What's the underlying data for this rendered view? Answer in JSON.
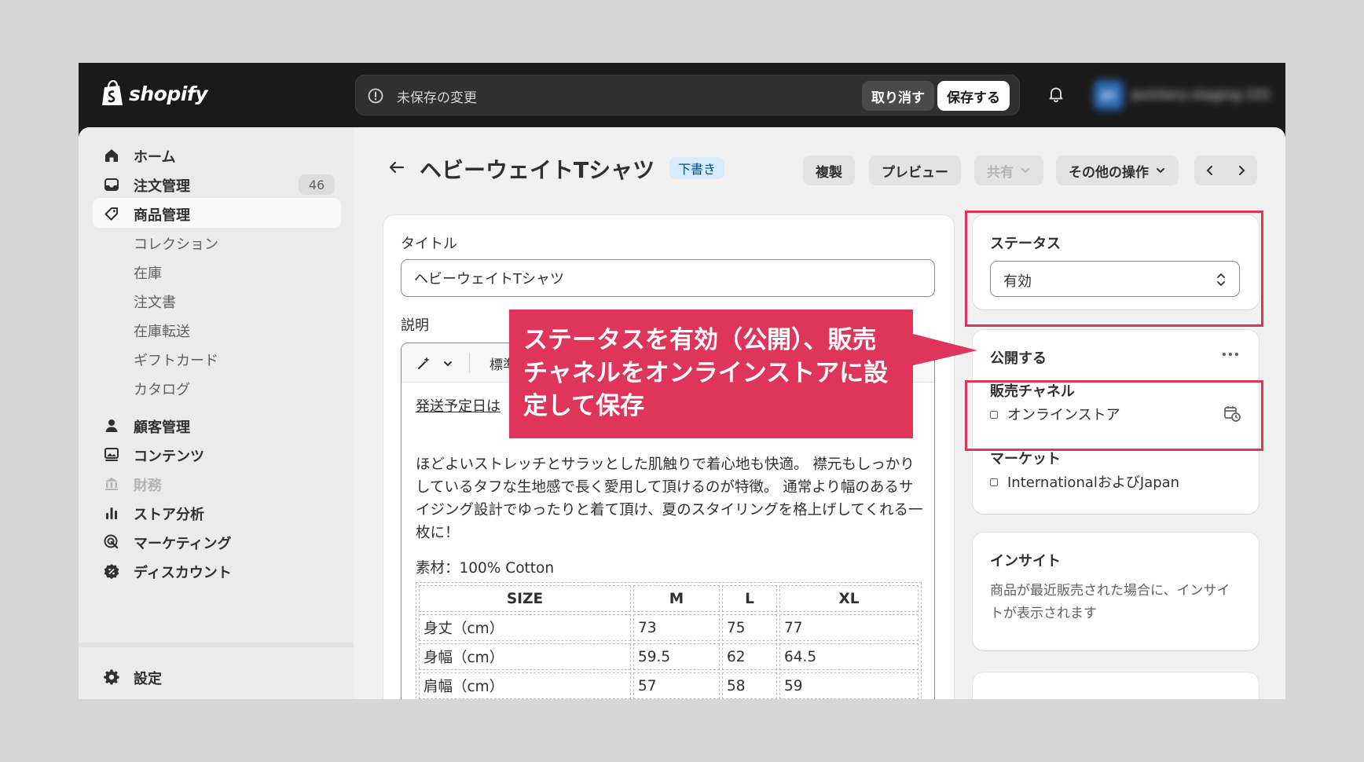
{
  "topbar": {
    "logo_text": "shopify",
    "unsaved_text": "未保存の変更",
    "discard_label": "取り消す",
    "save_label": "保存する",
    "store_avatar": "ps",
    "store_name": "pointery-staging-101"
  },
  "sidebar": {
    "home": "ホーム",
    "orders": "注文管理",
    "orders_count": "46",
    "products": "商品管理",
    "collections": "コレクション",
    "inventory": "在庫",
    "purchase_orders": "注文書",
    "transfers": "在庫転送",
    "gift_cards": "ギフトカード",
    "catalogs": "カタログ",
    "customers": "顧客管理",
    "content": "コンテンツ",
    "finance": "財務",
    "analytics": "ストア分析",
    "marketing": "マーケティング",
    "discounts": "ディスカウント",
    "settings": "設定"
  },
  "header": {
    "title": "ヘビーウェイトTシャツ",
    "badge": "下書き",
    "duplicate": "複製",
    "preview": "プレビュー",
    "share": "共有",
    "more_actions": "その他の操作"
  },
  "product": {
    "title_label": "タイトル",
    "title_value": "ヘビーウェイトTシャツ",
    "description_label": "説明",
    "format_label": "標準",
    "shipping_note": "発送予定日は",
    "description": "ほどよいストレッチとサラッとした肌触りで着心地も快適。 襟元もしっかりしているタフな生地感で長く愛用して頂けるのが特徴。 通常より幅のあるサイジング設計でゆったりと着て頂け、夏のスタイリングを格上げしてくれる一枚に！",
    "material": "素材：100% Cotton",
    "size_table": {
      "headers": [
        "SIZE",
        "M",
        "L",
        "XL"
      ],
      "rows": [
        [
          "身丈（cm）",
          "73",
          "75",
          "77"
        ],
        [
          "身幅（cm）",
          "59.5",
          "62",
          "64.5"
        ],
        [
          "肩幅（cm）",
          "57",
          "58",
          "59"
        ]
      ]
    }
  },
  "status": {
    "title": "ステータス",
    "value": "有効"
  },
  "publishing": {
    "title": "公開する",
    "channels_title": "販売チャネル",
    "channel": "オンラインストア",
    "markets_title": "マーケット",
    "market": "InternationalおよびJapan"
  },
  "insights": {
    "title": "インサイト",
    "text": "商品が最近販売された場合に、インサイトが表示されます"
  },
  "callout": {
    "text": "ステータスを有効（公開）、販売チャネルをオンラインストアに設定して保存"
  },
  "colors": {
    "highlight": "#e0355a",
    "topbar": "#1a1a1a",
    "draft_badge": "#d5ebff"
  }
}
